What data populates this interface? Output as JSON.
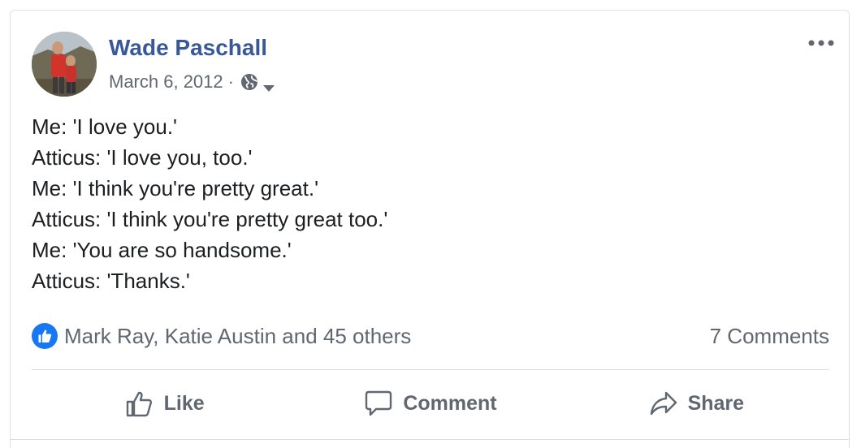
{
  "post": {
    "author_name": "Wade Paschall",
    "date": "March 6, 2012",
    "separator": "·",
    "privacy_icon": "globe-icon",
    "menu_icon": "more-options-icon",
    "body_lines": [
      "Me: 'I love you.'",
      "Atticus: 'I love you, too.'",
      "Me: 'I think you're pretty great.'",
      "Atticus: 'I think you're pretty great too.'",
      "Me: 'You are so handsome.'",
      "Atticus: 'Thanks.'"
    ]
  },
  "reactions": {
    "icon": "like-reaction-icon",
    "summary": "Mark Ray, Katie Austin and 45 others",
    "comments": "7 Comments"
  },
  "actions": {
    "like_label": "Like",
    "comment_label": "Comment",
    "share_label": "Share"
  },
  "colors": {
    "author_link": "#385898",
    "secondary_text": "#606770",
    "like_badge": "#1877f2",
    "divider": "#dadde1"
  }
}
